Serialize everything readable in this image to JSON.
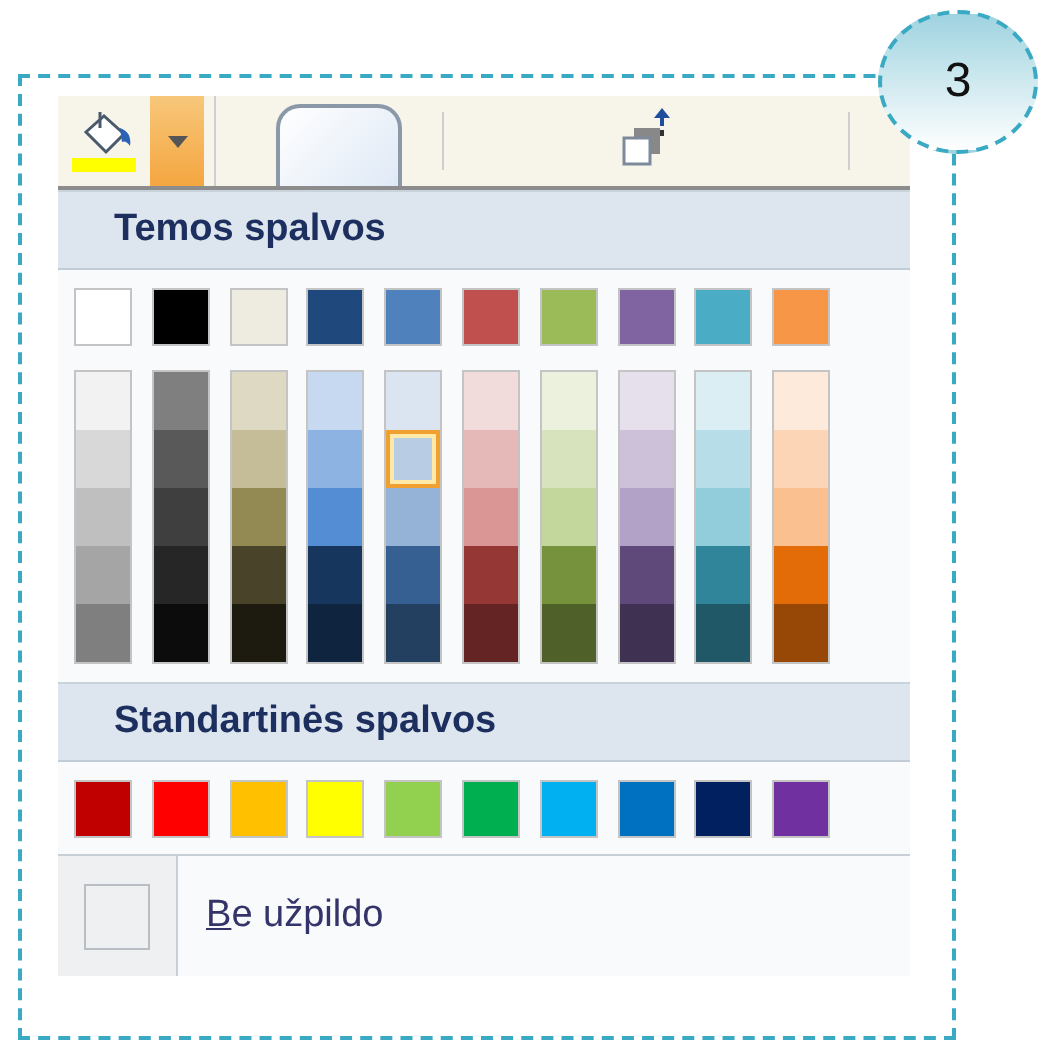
{
  "callout": {
    "label": "3"
  },
  "theme_section": {
    "title": "Temos spalvos"
  },
  "theme_colors": [
    {
      "color": "#ffffff",
      "selected": false,
      "shades": [
        {
          "color": "#f2f2f2",
          "selected": false
        },
        {
          "color": "#d8d8d8",
          "selected": false
        },
        {
          "color": "#bfbfbf",
          "selected": false
        },
        {
          "color": "#a5a5a5",
          "selected": false
        },
        {
          "color": "#7f7f7f",
          "selected": false
        }
      ]
    },
    {
      "color": "#000000",
      "selected": false,
      "shades": [
        {
          "color": "#7f7f7f",
          "selected": false
        },
        {
          "color": "#595959",
          "selected": false
        },
        {
          "color": "#3f3f3f",
          "selected": false
        },
        {
          "color": "#262626",
          "selected": false
        },
        {
          "color": "#0c0c0c",
          "selected": false
        }
      ]
    },
    {
      "color": "#eeece1",
      "selected": false,
      "shades": [
        {
          "color": "#ddd9c3",
          "selected": false
        },
        {
          "color": "#c4bd97",
          "selected": false
        },
        {
          "color": "#938953",
          "selected": false
        },
        {
          "color": "#494429",
          "selected": false
        },
        {
          "color": "#1d1b10",
          "selected": false
        }
      ]
    },
    {
      "color": "#1f497d",
      "selected": false,
      "shades": [
        {
          "color": "#c6d9f0",
          "selected": false
        },
        {
          "color": "#8db3e2",
          "selected": false
        },
        {
          "color": "#548dd4",
          "selected": false
        },
        {
          "color": "#17365d",
          "selected": false
        },
        {
          "color": "#0f243e",
          "selected": false
        }
      ]
    },
    {
      "color": "#4f81bd",
      "selected": false,
      "shades": [
        {
          "color": "#dbe5f1",
          "selected": false
        },
        {
          "color": "#b8cce4",
          "selected": true
        },
        {
          "color": "#95b3d7",
          "selected": false
        },
        {
          "color": "#366092",
          "selected": false
        },
        {
          "color": "#244061",
          "selected": false
        }
      ]
    },
    {
      "color": "#c0504d",
      "selected": false,
      "shades": [
        {
          "color": "#f2dcdb",
          "selected": false
        },
        {
          "color": "#e5b9b7",
          "selected": false
        },
        {
          "color": "#d99694",
          "selected": false
        },
        {
          "color": "#953734",
          "selected": false
        },
        {
          "color": "#632423",
          "selected": false
        }
      ]
    },
    {
      "color": "#9bbb59",
      "selected": false,
      "shades": [
        {
          "color": "#ebf1dd",
          "selected": false
        },
        {
          "color": "#d7e3bc",
          "selected": false
        },
        {
          "color": "#c3d69b",
          "selected": false
        },
        {
          "color": "#76923c",
          "selected": false
        },
        {
          "color": "#4f6128",
          "selected": false
        }
      ]
    },
    {
      "color": "#8064a2",
      "selected": false,
      "shades": [
        {
          "color": "#e5e0ec",
          "selected": false
        },
        {
          "color": "#ccc1d9",
          "selected": false
        },
        {
          "color": "#b2a2c7",
          "selected": false
        },
        {
          "color": "#5f497a",
          "selected": false
        },
        {
          "color": "#3f3151",
          "selected": false
        }
      ]
    },
    {
      "color": "#4bacc6",
      "selected": false,
      "shades": [
        {
          "color": "#dbeef3",
          "selected": false
        },
        {
          "color": "#b7dde8",
          "selected": false
        },
        {
          "color": "#92cddc",
          "selected": false
        },
        {
          "color": "#31859b",
          "selected": false
        },
        {
          "color": "#205867",
          "selected": false
        }
      ]
    },
    {
      "color": "#f79646",
      "selected": false,
      "shades": [
        {
          "color": "#fdeada",
          "selected": false
        },
        {
          "color": "#fbd5b5",
          "selected": false
        },
        {
          "color": "#fac08f",
          "selected": false
        },
        {
          "color": "#e36c09",
          "selected": false
        },
        {
          "color": "#974806",
          "selected": false
        }
      ]
    }
  ],
  "standard_section": {
    "title": "Standartinės spalvos"
  },
  "standard_colors": [
    {
      "color": "#c00000",
      "selected": false
    },
    {
      "color": "#ff0000",
      "selected": false
    },
    {
      "color": "#ffc000",
      "selected": false
    },
    {
      "color": "#ffff00",
      "selected": false
    },
    {
      "color": "#92d050",
      "selected": false
    },
    {
      "color": "#00b050",
      "selected": false
    },
    {
      "color": "#00b0f0",
      "selected": false
    },
    {
      "color": "#0070c0",
      "selected": false
    },
    {
      "color": "#002060",
      "selected": false
    },
    {
      "color": "#7030a0",
      "selected": false
    }
  ],
  "no_fill": {
    "label": "Be užpildo"
  }
}
